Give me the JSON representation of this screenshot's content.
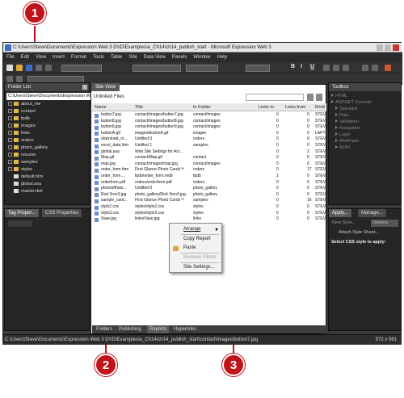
{
  "callouts": {
    "c1": "1",
    "c2": "2",
    "c3": "3"
  },
  "window": {
    "title": "C:\\Users\\Steve\\Documents\\Expression Web 3 DVD\\Examples\\e_Ch14\\ch14_publish_start - Microsoft Expression Web 3"
  },
  "menu": [
    "File",
    "Edit",
    "View",
    "Insert",
    "Format",
    "Tools",
    "Table",
    "Site",
    "Data View",
    "Panels",
    "Window",
    "Help"
  ],
  "toolbar": {
    "style_dropdown": "(None)",
    "bold": "B",
    "italic": "I",
    "underline": "U"
  },
  "folder_list": {
    "title": "Folder List",
    "path": "C:\\Users\\Steve\\Documents\\Expression W",
    "items": [
      "about_me",
      "contact",
      "fpdb",
      "images",
      "links",
      "orders",
      "photo_gallery",
      "resume",
      "samples",
      "styles",
      "default.htm",
      "global.asa",
      "master.dwt"
    ]
  },
  "bottom_left_tabs": {
    "tag_properties": "Tag Proper...",
    "css_properties": "CSS Properties"
  },
  "site_view": {
    "tab": "Site View",
    "report_name": "Unlinked Files",
    "columns": {
      "name": "Name",
      "title": "Title",
      "in_folder": "In Folder",
      "links_to": "Links to",
      "links_from": "Links from",
      "modified_by": "Modi"
    },
    "rows": [
      {
        "name": "button7.jpg",
        "title": "contact/images/button7.jpg",
        "folder": "contact/images",
        "to": "0",
        "from": "0",
        "mod": "STEV"
      },
      {
        "name": "button8.jpg",
        "title": "contact/images/button8.jpg",
        "folder": "contact/images",
        "to": "0",
        "from": "0",
        "mod": "STEV"
      },
      {
        "name": "button9.jpg",
        "title": "contact/images/button9.jpg",
        "folder": "contact/images",
        "to": "0",
        "from": "0",
        "mod": "STEV"
      },
      {
        "name": "buttonA.gif",
        "title": "images/buttonA.gif",
        "folder": "images",
        "to": "0",
        "from": "0",
        "mod": "LAPT"
      },
      {
        "name": "download_or...",
        "title": "Untitled 0",
        "folder": "orders",
        "to": "0",
        "from": "0",
        "mod": "STEV"
      },
      {
        "name": "excel_data.htm",
        "title": "Untitled 1",
        "folder": "samples",
        "to": "0",
        "from": "0",
        "mod": "STEV"
      },
      {
        "name": "global.asa",
        "title": "Web Site Settings for Act...",
        "folder": "",
        "to": "0",
        "from": "2",
        "mod": "STEV"
      },
      {
        "name": "Map.gif",
        "title": "contact/Map.gif",
        "folder": "contact",
        "to": "0",
        "from": "0",
        "mod": "STEV"
      },
      {
        "name": "map.jpg",
        "title": "contact/images/map.jpg",
        "folder": "contact/images",
        "to": "0",
        "from": "0",
        "mod": "STEV"
      },
      {
        "name": "order_form.htm",
        "title": "First Glance Photo Cards™",
        "folder": "orders",
        "to": "0",
        "from": "17",
        "mod": "STEV"
      },
      {
        "name": "order_form....",
        "title": "fpdb/order_form.mdb",
        "folder": "fpdb",
        "to": "1",
        "from": "0",
        "mod": "STEV"
      },
      {
        "name": "orderform.pdf",
        "title": "orders/orderform.pdf",
        "folder": "orders",
        "to": "0",
        "from": "0",
        "mod": "STEV"
      },
      {
        "name": "photoofthew...",
        "title": "Untitled 0",
        "folder": "photo_gallery",
        "to": "0",
        "from": "0",
        "mod": "STEV"
      },
      {
        "name": "Rod 3ron3.jpg",
        "title": "photo_gallery/Rod 3ron3.jpg",
        "folder": "photo_gallery",
        "to": "0",
        "from": "0",
        "mod": "STEV"
      },
      {
        "name": "sample_card...",
        "title": "First Glance Photo Cards™",
        "folder": "samples",
        "to": "0",
        "from": "16",
        "mod": "STEV"
      },
      {
        "name": "style2.css",
        "title": "styles/style2.css",
        "folder": "styles",
        "to": "0",
        "from": "0",
        "mod": "STEV"
      },
      {
        "name": "style3.css",
        "title": "styles/style3.css",
        "folder": "styles",
        "to": "0",
        "from": "0",
        "mod": "STEV"
      },
      {
        "name": "Vase.jpg",
        "title": "links/Vase.jpg",
        "folder": "links",
        "to": "0",
        "from": "0",
        "mod": "STEV"
      }
    ],
    "bottom_tabs": [
      "Folders",
      "Publishing",
      "Reports",
      "Hyperlinks"
    ]
  },
  "context_menu": {
    "arrange": "Arrange",
    "copy_report": "Copy Report",
    "paste": "Paste",
    "remove_filters": "Remove Filters",
    "site_settings": "Site Settings..."
  },
  "toolbox": {
    "title": "Toolbox",
    "items": [
      "HTML",
      "ASP.NET Controls",
      "Standard",
      "Data",
      "Validation",
      "Navigation",
      "Login",
      "WebParts",
      "AJAX"
    ]
  },
  "apply_panel": {
    "tab1": "Apply...",
    "tab2": "Manage...",
    "new_style": "New Style...",
    "options": "Options",
    "attach": "Attach Style Sheet...",
    "select_label": "Select CSS style to apply:"
  },
  "statusbar": {
    "path": "C:\\Users\\Steve\\Documents\\Expression Web 3 DVD\\Examples\\e_Ch14\\ch14_publish_start\\contact\\images\\button7.jpg",
    "size": "572 x 561"
  }
}
